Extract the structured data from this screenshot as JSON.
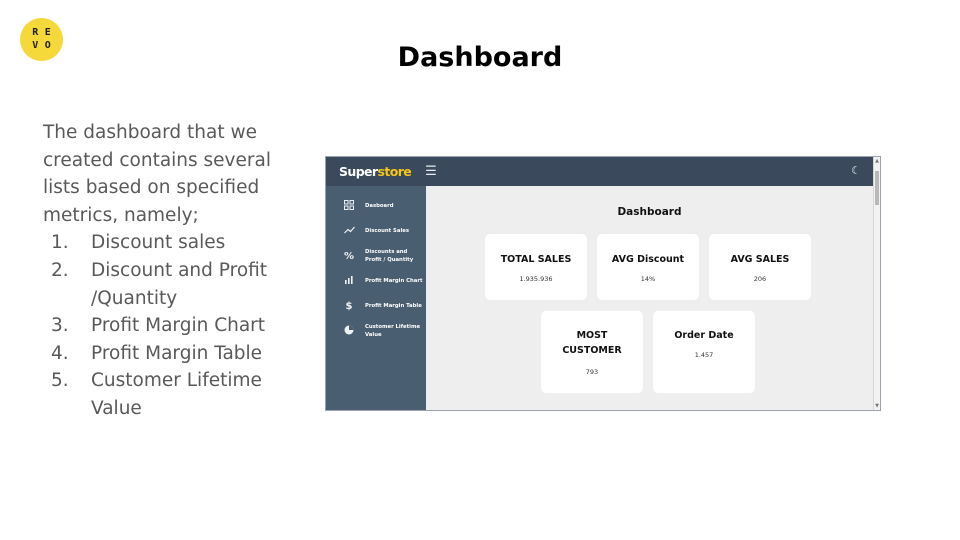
{
  "logo": {
    "letters": [
      "R",
      "E",
      "V",
      "O"
    ],
    "color": "#f5d93a"
  },
  "slide": {
    "title": "Dashboard",
    "intro": "The dashboard that we created contains several lists based on specified metrics, namely;",
    "list": [
      {
        "num": "1.",
        "text": "Discount sales"
      },
      {
        "num": "2.",
        "text": "Discount and Profit /Quantity"
      },
      {
        "num": "3.",
        "text": "Profit Margin Chart"
      },
      {
        "num": "4.",
        "text": "Profit Margin Table"
      },
      {
        "num": "5.",
        "text": "Customer Lifetime Value"
      }
    ]
  },
  "app": {
    "brand_part1": "Super",
    "brand_part2": "store",
    "brand_colors": {
      "primary": "#ffffff",
      "accent": "#f5c518"
    },
    "topbar_color": "#3a4a5c",
    "sidebar_color": "#4a5e72",
    "icons": {
      "menu": "hamburger-icon",
      "theme": "moon-icon"
    },
    "sidebar": [
      {
        "label": "Dasboard",
        "icon": "grid-icon"
      },
      {
        "label": "Discount Sales",
        "icon": "trend-line-icon"
      },
      {
        "label": "Discounts and Profit / Quantity",
        "icon": "percent-icon"
      },
      {
        "label": "Profit Margin Chart",
        "icon": "bar-chart-icon"
      },
      {
        "label": "Profit Margin Table",
        "icon": "dollar-icon"
      },
      {
        "label": "Customer Lifetime Value",
        "icon": "pie-icon"
      }
    ],
    "main_title": "Dashboard",
    "cards": [
      {
        "title": "TOTAL SALES",
        "value": "1.935.936"
      },
      {
        "title": "AVG Discount",
        "value": "14%"
      },
      {
        "title": "AVG SALES",
        "value": "206"
      },
      {
        "title": "MOST CUSTOMER",
        "value": "793"
      },
      {
        "title": "Order Date",
        "value": "1.457"
      }
    ]
  }
}
